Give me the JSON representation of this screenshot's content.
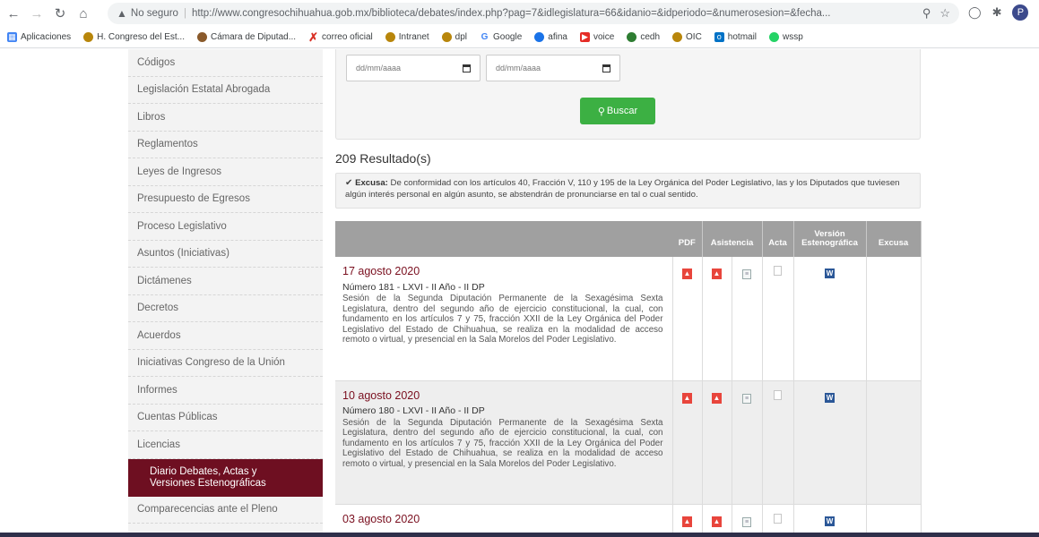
{
  "browser": {
    "security_label": "No seguro",
    "url": "http://www.congresochihuahua.gob.mx/biblioteca/debates/index.php?pag=7&idlegislatura=66&idanio=&idperiodo=&numerosesion=&fecha...",
    "profile_initial": "P"
  },
  "bookmarks": [
    {
      "label": "Aplicaciones",
      "icon": "apps-grid-icon",
      "color": "#4285f4"
    },
    {
      "label": "H. Congreso del Est...",
      "icon": "congress-seal-icon",
      "color": "#b8860b"
    },
    {
      "label": "Cámara de Diputad...",
      "icon": "camara-logo-icon",
      "color": "#8a5a2b"
    },
    {
      "label": "correo oficial",
      "icon": "red-x-icon",
      "color": "#d93025"
    },
    {
      "label": "Intranet",
      "icon": "congress-seal-icon",
      "color": "#b8860b"
    },
    {
      "label": "dpl",
      "icon": "congress-seal-icon",
      "color": "#b8860b"
    },
    {
      "label": "Google",
      "icon": "google-g-icon",
      "color": "#4285f4"
    },
    {
      "label": "afina",
      "icon": "afina-icon",
      "color": "#1a73e8"
    },
    {
      "label": "voice",
      "icon": "youtube-icon",
      "color": "#e52d27"
    },
    {
      "label": "cedh",
      "icon": "cedh-icon",
      "color": "#2e7d32"
    },
    {
      "label": "OIC",
      "icon": "congress-seal-icon",
      "color": "#b8860b"
    },
    {
      "label": "hotmail",
      "icon": "outlook-icon",
      "color": "#0072c6"
    },
    {
      "label": "wssp",
      "icon": "whatsapp-icon",
      "color": "#25d366"
    }
  ],
  "sidebar": {
    "items": [
      {
        "label": "Códigos"
      },
      {
        "label": "Legislación Estatal Abrogada"
      },
      {
        "label": "Libros"
      },
      {
        "label": "Reglamentos"
      },
      {
        "label": "Leyes de Ingresos"
      },
      {
        "label": "Presupuesto de Egresos"
      },
      {
        "label": "Proceso Legislativo"
      },
      {
        "label": "Asuntos (Iniciativas)"
      },
      {
        "label": "Dictámenes"
      },
      {
        "label": "Decretos"
      },
      {
        "label": "Acuerdos"
      },
      {
        "label": "Iniciativas Congreso de la Unión"
      },
      {
        "label": "Informes"
      },
      {
        "label": "Cuentas Públicas"
      },
      {
        "label": "Licencias"
      },
      {
        "label_line1": "Diario Debates, Actas y",
        "label_line2": "Versiones Estenográficas"
      },
      {
        "label": "Comparecencias ante el Pleno"
      }
    ]
  },
  "search": {
    "date_from_placeholder": "dd/mm/aaaa",
    "date_to_placeholder": "dd/mm/aaaa",
    "button_label": "Buscar"
  },
  "results": {
    "count_label": "209 Resultado(s)",
    "notice_title": "Excusa:",
    "notice_text": "De conformidad con los artículos 40, Fracción V, 110 y 195 de la Ley Orgánica del Poder Legislativo, las y los Diputados que tuviesen algún interés personal en algún asunto, se abstendrán de pronunciarse en tal o cual sentido."
  },
  "table": {
    "headers": {
      "pdf": "PDF",
      "asistencia": "Asistencia",
      "acta": "Acta",
      "version_line1": "Versión",
      "version_line2": "Estenográfica",
      "excusa": "Excusa"
    },
    "rows": [
      {
        "date": "17 agosto 2020",
        "number": "Número 181 - LXVI - II Año - II DP",
        "description": "Sesión de la Segunda Diputación Permanente de la Sexagésima Sexta Legislatura, dentro del segundo año de ejercicio constitucional, la cual, con fundamento en los artículos 7 y 75, fracción XXII de la Ley Orgánica del Poder Legislativo del Estado de Chihuahua, se realiza en la modalidad de acceso remoto o virtual, y presencial en la Sala Morelos del Poder Legislativo."
      },
      {
        "date": "10 agosto 2020",
        "number": "Número 180 - LXVI - II Año - II DP",
        "description": "Sesión de la Segunda Diputación Permanente de la Sexagésima Sexta Legislatura, dentro del segundo año de ejercicio constitucional, la cual, con fundamento en los artículos 7 y 75, fracción XXII de la Ley Orgánica del Poder Legislativo del Estado de Chihuahua, se realiza en la modalidad de acceso remoto o virtual, y presencial en la Sala Morelos del Poder Legislativo."
      },
      {
        "date": "03 agosto 2020",
        "number": "",
        "description": ""
      }
    ]
  }
}
